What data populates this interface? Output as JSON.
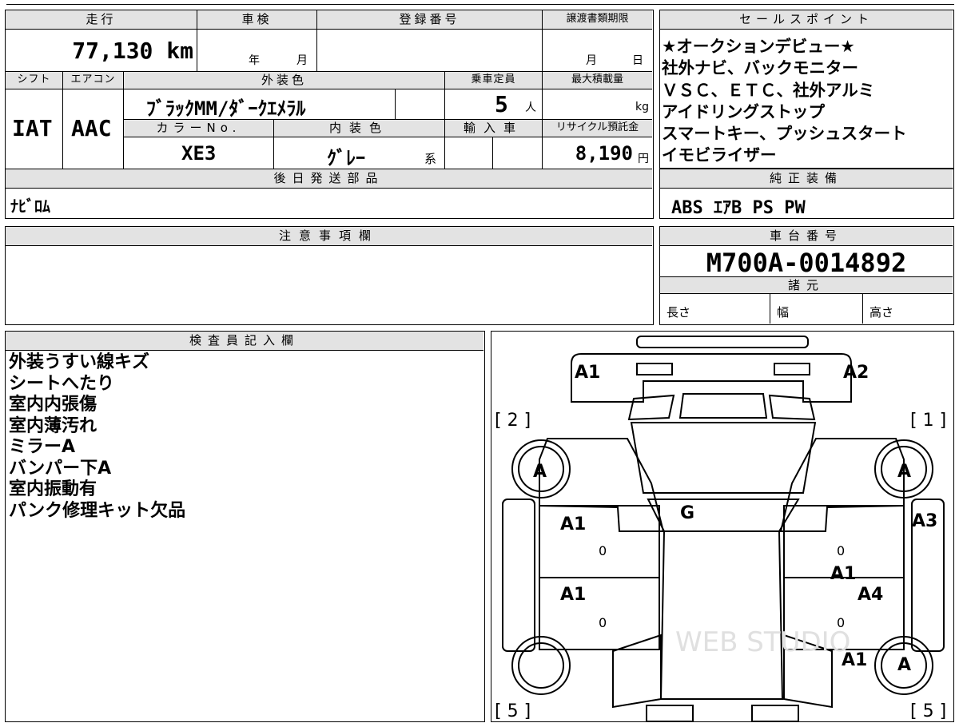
{
  "top_left": {
    "labels": {
      "mileage": "走行",
      "inspection": "車検",
      "registration": "登録番号",
      "deadline": "譲渡書類期限",
      "shift": "シフト",
      "aircon": "エアコン",
      "exterior_color": "外装色",
      "capacity": "乗車定員",
      "max_load": "最大積載量",
      "color_no": "カラーNo.",
      "interior_color": "内装色",
      "import": "輸入車",
      "recycle": "リサイクル預託金",
      "later_parts": "後日発送部品"
    },
    "mileage": "77,130",
    "mileage_unit": "km",
    "inspection_year": "年",
    "inspection_month": "月",
    "deadline_month": "月",
    "deadline_day": "日",
    "shift": "IAT",
    "aircon": "AAC",
    "exterior_color": "ﾌﾞﾗｯｸMM/ﾀﾞｰｸｴﾒﾗﾙ",
    "capacity": "5",
    "capacity_unit": "人",
    "max_load_unit": "kg",
    "color_no": "XE3",
    "interior_color": "ｸﾞﾚｰ",
    "interior_suffix": "系",
    "recycle": "8,190",
    "recycle_unit": "円",
    "later_parts": "ﾅﾋﾞﾛﾑ"
  },
  "sales": {
    "header": "セールスポイント",
    "lines": [
      "★オークションデビュー★",
      "社外ナビ、バックモニター",
      "ＶＳＣ、ＥＴＣ、社外アルミ",
      "アイドリングストップ",
      "スマートキー、プッシュスタート",
      "イモビライザー"
    ]
  },
  "equipment": {
    "header": "純正装備",
    "value": "ABS ｴｱB PS PW"
  },
  "caution": {
    "header": "注意事項欄"
  },
  "chassis": {
    "header": "車台番号",
    "value": "M700A-0014892"
  },
  "specs": {
    "header": "諸元",
    "length": "長さ",
    "width": "幅",
    "height": "高さ"
  },
  "inspector": {
    "header": "検査員記入欄",
    "notes": [
      "外装うすい線キズ",
      "シートへたり",
      "室内内張傷",
      "室内薄汚れ",
      "ミラーA",
      "バンパー下A",
      "室内振動有",
      "パンク修理キット欠品"
    ]
  },
  "diagram": {
    "marks": {
      "front_left": "A1",
      "front_right": "A2",
      "window_left": "[ 2 ]",
      "window_right": "[ 1 ]",
      "wheel_fl": "A",
      "wheel_fr": "A",
      "roof": "G",
      "door_fl": "A1",
      "door_fr": "A3",
      "sill_fr": "A1",
      "door_rl": "A1",
      "door_rr": "A4",
      "fender_rr": "A1",
      "wheel_rr": "A",
      "window_rl": "[ 5 ]",
      "window_rr": "[ 5 ]",
      "zero_fl": "0",
      "zero_fr": "0",
      "zero_rl": "0",
      "zero_rr": "0"
    },
    "watermark": "WEB STUDIO"
  }
}
